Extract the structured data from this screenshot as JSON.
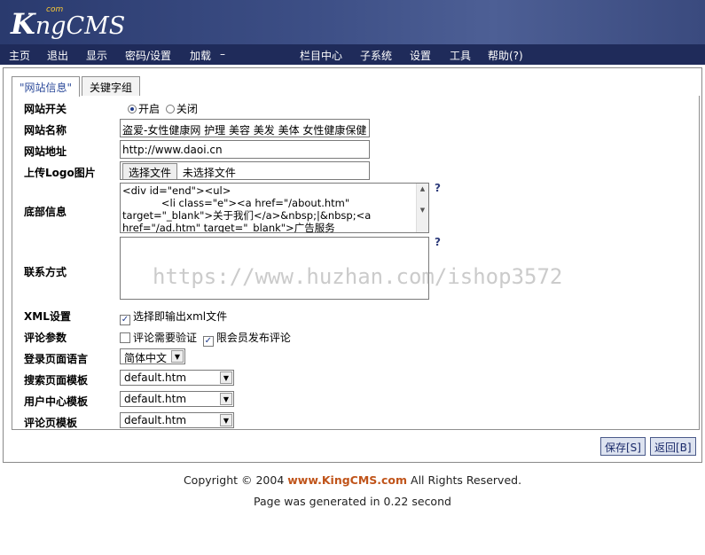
{
  "app": {
    "logo_main": "ngCMS",
    "logo_k": "K",
    "logo_com": "com"
  },
  "nav": {
    "items": [
      "主页",
      "退出",
      "显示",
      "密码/设置",
      "加载",
      "–",
      "栏目中心",
      "子系统",
      "设置",
      "工具",
      "帮助(?)"
    ]
  },
  "tabs": {
    "active": "\"网站信息\"",
    "other": "关键字组"
  },
  "form": {
    "site_switch": {
      "label": "网站开关",
      "on": "开启",
      "off": "关闭",
      "selected": "开启"
    },
    "site_name": {
      "label": "网站名称",
      "value": "盗爱-女性健康网 护理 美容 美发 美体 女性健康保健"
    },
    "site_url": {
      "label": "网站地址",
      "value": "http://www.daoi.cn"
    },
    "logo_upload": {
      "label": "上传Logo图片",
      "button": "选择文件",
      "status": "未选择文件"
    },
    "footer_info": {
      "label": "底部信息",
      "lines": [
        "<div id=\"end\"><ul>",
        "            <li class=\"e\"><a href=\"/about.htm\"",
        "target=\"_blank\">关于我们</a>&nbsp;|&nbsp;<a",
        "href=\"/ad.htm\" target=\"_blank\">广告服务"
      ],
      "help": "?"
    },
    "contact": {
      "label": "联系方式",
      "value": "",
      "help": "?"
    },
    "xml": {
      "label": "XML设置",
      "option": "选择即输出xml文件",
      "checked": true
    },
    "comment": {
      "label": "评论参数",
      "option1": "评论需要验证",
      "option1_checked": false,
      "option2": "限会员发布评论",
      "option2_checked": true
    },
    "login_lang": {
      "label": "登录页面语言",
      "value": "简体中文"
    },
    "search_tpl": {
      "label": "搜索页面模板",
      "value": "default.htm"
    },
    "user_tpl": {
      "label": "用户中心模板",
      "value": "default.htm"
    },
    "comment_tpl": {
      "label": "评论页模板",
      "value": "default.htm"
    }
  },
  "buttons": {
    "save": "保存[S]",
    "back": "返回[B]"
  },
  "watermark": "https://www.huzhan.com/ishop3572",
  "footer": {
    "copyright_pre": "Copyright © 2004 ",
    "brand": "www.KingCMS.com",
    "copyright_post": " All Rights Reserved.",
    "generated": "Page was generated in 0.22 second"
  }
}
